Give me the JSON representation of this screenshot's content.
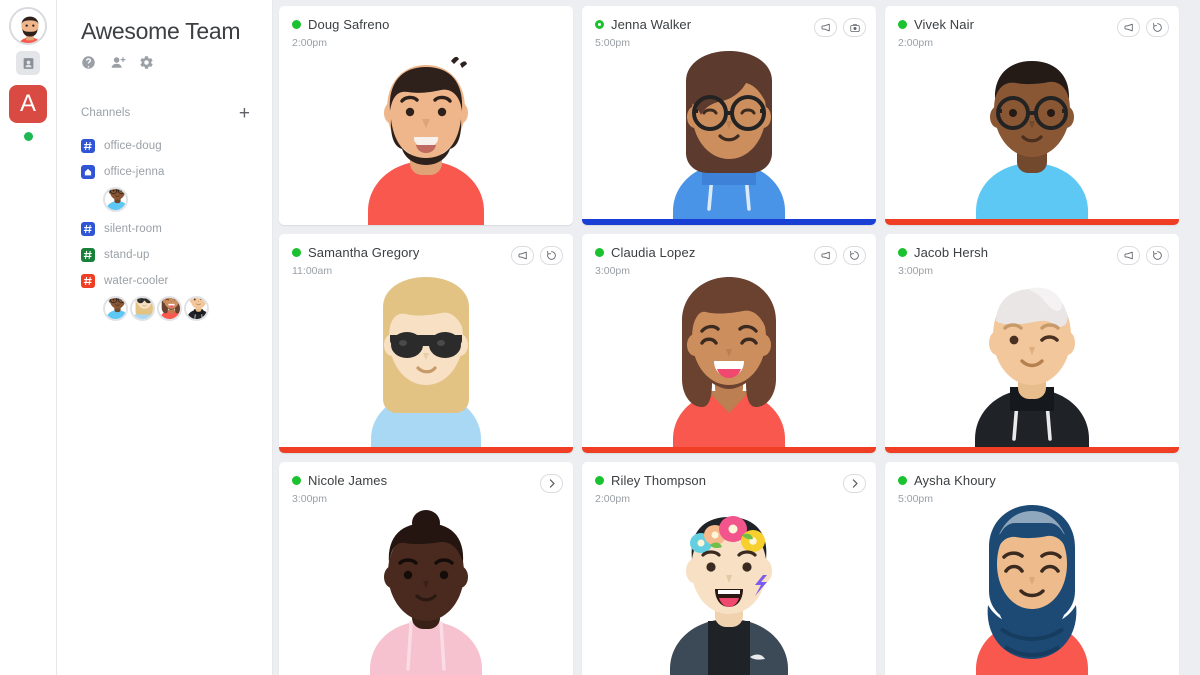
{
  "rail": {
    "avatar_name": "doug-avatar",
    "contacts_icon": "contacts-icon",
    "app_tile_label": "A",
    "status_dot_color": "#1db954"
  },
  "sidebar": {
    "team_title": "Awesome Team",
    "actions": [
      {
        "name": "help-icon",
        "label": "Help"
      },
      {
        "name": "add-person-icon",
        "label": "Add people"
      },
      {
        "name": "gear-icon",
        "label": "Settings"
      }
    ],
    "channels_label": "Channels",
    "add_channel_label": "+",
    "channels": [
      {
        "name": "office-doug",
        "icon": "hash-icon",
        "color": "#2f55d4",
        "members": []
      },
      {
        "name": "office-jenna",
        "icon": "door-icon",
        "color": "#2f55d4",
        "members": [
          "vivek"
        ]
      },
      {
        "name": "silent-room",
        "icon": "hash-icon",
        "color": "#2f55d4",
        "members": []
      },
      {
        "name": "stand-up",
        "icon": "hash-icon",
        "color": "#188038",
        "members": []
      },
      {
        "name": "water-cooler",
        "icon": "hash-icon",
        "color": "#f03e24",
        "members": [
          "vivek",
          "samantha",
          "claudia",
          "jacob"
        ]
      }
    ]
  },
  "main": {
    "cards": [
      {
        "name": "Doug Safreno",
        "time": "2:00pm",
        "status": "solid",
        "avatar": "doug",
        "buttons": [],
        "bar_color": null
      },
      {
        "name": "Jenna Walker",
        "time": "5:00pm",
        "status": "ring",
        "avatar": "jenna",
        "buttons": [
          {
            "name": "megaphone-icon"
          },
          {
            "name": "camera-icon"
          }
        ],
        "bar_color": "#1a3fd4"
      },
      {
        "name": "Vivek Nair",
        "time": "2:00pm",
        "status": "solid",
        "avatar": "vivek",
        "buttons": [
          {
            "name": "megaphone-icon"
          },
          {
            "name": "replay-icon"
          }
        ],
        "bar_color": "#f03e24"
      },
      {
        "name": "Samantha Gregory",
        "time": "11:00am",
        "status": "solid",
        "avatar": "samantha",
        "buttons": [
          {
            "name": "megaphone-icon"
          },
          {
            "name": "replay-icon"
          }
        ],
        "bar_color": "#f03e24"
      },
      {
        "name": "Claudia Lopez",
        "time": "3:00pm",
        "status": "solid",
        "avatar": "claudia",
        "buttons": [
          {
            "name": "megaphone-icon"
          },
          {
            "name": "replay-icon"
          }
        ],
        "bar_color": "#f03e24"
      },
      {
        "name": "Jacob Hersh",
        "time": "3:00pm",
        "status": "solid",
        "avatar": "jacob",
        "buttons": [
          {
            "name": "megaphone-icon"
          },
          {
            "name": "replay-icon"
          }
        ],
        "bar_color": "#f03e24"
      },
      {
        "name": "Nicole James",
        "time": "3:00pm",
        "status": "solid",
        "avatar": "nicole",
        "buttons": [
          {
            "name": "chevron-right-icon"
          }
        ],
        "bar_color": null
      },
      {
        "name": "Riley Thompson",
        "time": "2:00pm",
        "status": "solid",
        "avatar": "riley",
        "buttons": [
          {
            "name": "chevron-right-icon"
          }
        ],
        "bar_color": null
      },
      {
        "name": "Aysha Khoury",
        "time": "5:00pm",
        "status": "solid",
        "avatar": "aysha",
        "buttons": [],
        "bar_color": null
      }
    ]
  },
  "colors": {
    "online_green": "#19c22e",
    "channel_blue": "#2f55d4",
    "channel_green": "#188038",
    "channel_red": "#f03e24",
    "bar_blue": "#1a3fd4",
    "bar_red": "#f03e24",
    "app_red": "#d94a42"
  }
}
